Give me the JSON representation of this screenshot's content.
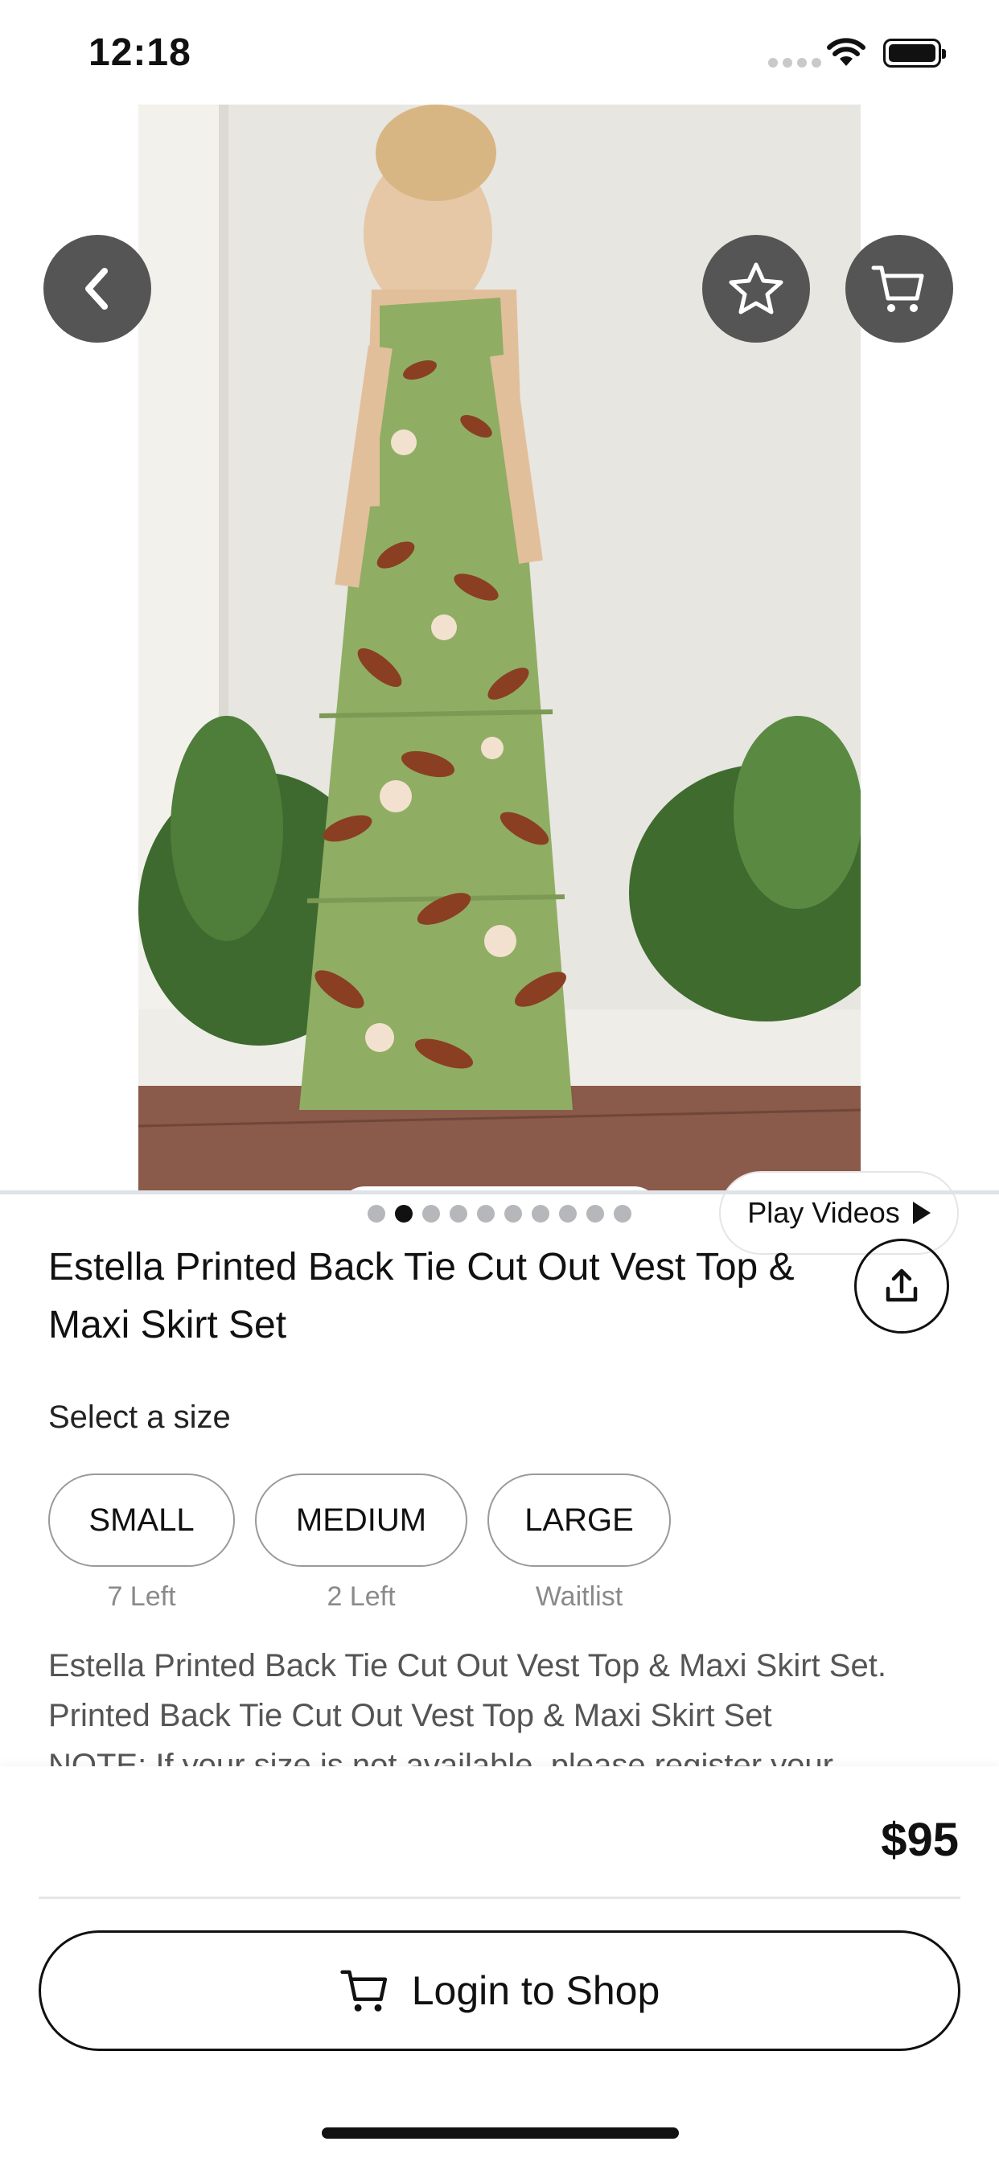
{
  "status_bar": {
    "time": "12:18"
  },
  "hero": {
    "photo_alt": "Model wearing green floral printed vest top and tiered maxi skirt",
    "pager": {
      "count": 10,
      "active_index": 1
    },
    "play_videos_label": "Play Videos"
  },
  "icons": {
    "back": "chevron-left-icon",
    "favorite": "star-icon",
    "cart": "cart-icon",
    "share": "share-icon",
    "play": "play-icon"
  },
  "product": {
    "title": "Estella Printed Back Tie Cut Out Vest Top & Maxi Skirt Set",
    "select_size_label": "Select a size",
    "sizes": [
      {
        "label": "SMALL",
        "availability": "7 Left"
      },
      {
        "label": "MEDIUM",
        "availability": "2 Left"
      },
      {
        "label": "LARGE",
        "availability": "Waitlist"
      }
    ],
    "description_lines": [
      "Estella Printed Back Tie Cut Out Vest Top & Maxi Skirt Set.",
      "Printed Back Tie Cut Out Vest Top & Maxi Skirt Set",
      "NOTE: If your size is not available, please register your"
    ]
  },
  "bottom_bar": {
    "price": "$95",
    "login_button_label": "Login to Shop"
  },
  "colors": {
    "button_dark": "#555555",
    "text": "#111111",
    "dress_green": "#8fae63",
    "leaf_brown": "#8a3f22"
  }
}
